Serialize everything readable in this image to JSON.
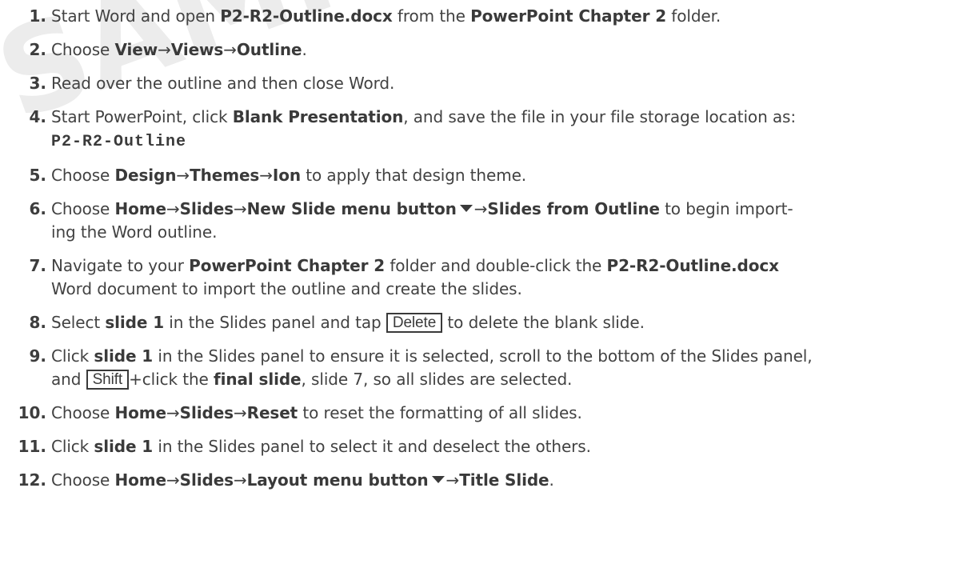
{
  "watermark": {
    "text": "SAMPLE"
  },
  "steps": [
    {
      "num": "1.",
      "parts": [
        {
          "t": "Start Word and open "
        },
        {
          "t": "P2-R2-Outline.docx",
          "b": true
        },
        {
          "t": " from the "
        },
        {
          "t": "PowerPoint Chapter 2",
          "b": true
        },
        {
          "t": " folder."
        }
      ]
    },
    {
      "num": "2.",
      "parts": [
        {
          "t": "Choose "
        },
        {
          "t": "View",
          "b": true
        },
        {
          "t": "→",
          "arrow": true
        },
        {
          "t": "Views",
          "b": true
        },
        {
          "t": "→",
          "arrow": true
        },
        {
          "t": "Outline",
          "b": true
        },
        {
          "t": "."
        }
      ]
    },
    {
      "num": "3.",
      "parts": [
        {
          "t": "Read over the outline and then close Word."
        }
      ]
    },
    {
      "num": "4.",
      "parts": [
        {
          "t": "Start PowerPoint, click "
        },
        {
          "t": "Blank Presentation",
          "b": true
        },
        {
          "t": ", and save the file in your file storage location as:"
        },
        {
          "br": true
        },
        {
          "t": "P2-R2-Outline",
          "code": true
        }
      ]
    },
    {
      "num": "5.",
      "parts": [
        {
          "t": "Choose "
        },
        {
          "t": "Design",
          "b": true
        },
        {
          "t": "→",
          "arrow": true
        },
        {
          "t": "Themes",
          "b": true
        },
        {
          "t": "→",
          "arrow": true
        },
        {
          "t": "Ion",
          "b": true
        },
        {
          "t": " to apply that design theme."
        }
      ]
    },
    {
      "num": "6.",
      "parts": [
        {
          "t": "Choose "
        },
        {
          "t": "Home",
          "b": true
        },
        {
          "t": "→",
          "arrow": true
        },
        {
          "t": "Slides",
          "b": true
        },
        {
          "t": "→",
          "arrow": true
        },
        {
          "t": "New Slide menu button",
          "b": true
        },
        {
          "caret": true,
          "icon": "dropdown-caret-icon"
        },
        {
          "t": "→",
          "arrow": true
        },
        {
          "t": "Slides from Outline",
          "b": true
        },
        {
          "t": " to begin import-"
        },
        {
          "br": true
        },
        {
          "t": "ing the Word outline."
        }
      ]
    },
    {
      "num": "7.",
      "parts": [
        {
          "t": "Navigate to your "
        },
        {
          "t": "PowerPoint Chapter 2",
          "b": true
        },
        {
          "t": " folder and double-click the "
        },
        {
          "t": "P2-R2-Outline.docx",
          "b": true
        },
        {
          "br": true
        },
        {
          "t": "Word document to import the outline and create the slides."
        }
      ]
    },
    {
      "num": "8.",
      "parts": [
        {
          "t": "Select "
        },
        {
          "t": "slide 1",
          "b": true
        },
        {
          "t": " in the Slides panel and tap "
        },
        {
          "t": "Delete",
          "key": true
        },
        {
          "t": " to delete the blank slide."
        }
      ]
    },
    {
      "num": "9.",
      "parts": [
        {
          "t": "Click "
        },
        {
          "t": "slide 1",
          "b": true
        },
        {
          "t": " in the Slides panel to ensure it is selected, scroll to the bottom of the Slides panel,"
        },
        {
          "br": true
        },
        {
          "t": "and "
        },
        {
          "t": "Shift",
          "key": true
        },
        {
          "t": "+click the "
        },
        {
          "t": "final slide",
          "b": true
        },
        {
          "t": ", slide 7, so all slides are selected."
        }
      ]
    },
    {
      "num": "10.",
      "parts": [
        {
          "t": "Choose "
        },
        {
          "t": "Home",
          "b": true
        },
        {
          "t": "→",
          "arrow": true
        },
        {
          "t": "Slides",
          "b": true
        },
        {
          "t": "→",
          "arrow": true
        },
        {
          "t": "Reset",
          "b": true
        },
        {
          "t": " to reset the formatting of all slides."
        }
      ]
    },
    {
      "num": "11.",
      "parts": [
        {
          "t": "Click "
        },
        {
          "t": "slide 1",
          "b": true
        },
        {
          "t": " in the Slides panel to select it and deselect the others."
        }
      ]
    },
    {
      "num": "12.",
      "parts": [
        {
          "t": "Choose "
        },
        {
          "t": "Home",
          "b": true
        },
        {
          "t": "→",
          "arrow": true
        },
        {
          "t": "Slides",
          "b": true
        },
        {
          "t": "→",
          "arrow": true
        },
        {
          "t": "Layout menu button",
          "b": true
        },
        {
          "caret": true,
          "icon": "dropdown-caret-icon"
        },
        {
          "t": "→",
          "arrow": true
        },
        {
          "t": "Title Slide",
          "b": true
        },
        {
          "t": "."
        }
      ]
    }
  ]
}
